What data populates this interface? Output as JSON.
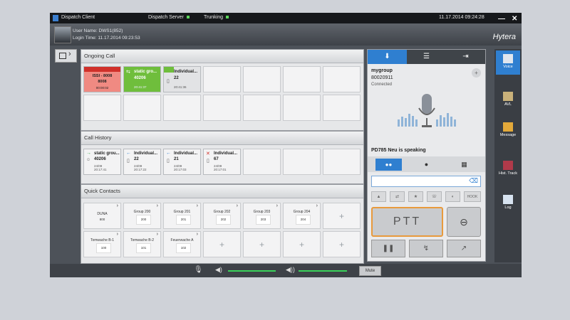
{
  "titlebar": {
    "app": "Dispatch Client",
    "server": "Dispatch Server",
    "trunking": "Trunking",
    "datetime": "11.17.2014 09:24:28",
    "min": "—",
    "close": "✕"
  },
  "user": {
    "name": "User Name: DWS1(852)",
    "login": "Login Time: 11.17.2014 09:23:53"
  },
  "brand": "Hytera",
  "ongoing": {
    "title": "Ongoing Call",
    "tiles": [
      {
        "name": "ISSI - 8008",
        "id": "8008",
        "time": "00:00:02",
        "color": "#f08a82"
      },
      {
        "name": "static gro...",
        "id": "40206",
        "time": "20:41:37",
        "color": "#6fbe3c"
      },
      {
        "name": "Individual...",
        "id": "22",
        "time": "20:41:36",
        "color": "#e2e3e5"
      }
    ]
  },
  "history": {
    "title": "Call History",
    "tiles": [
      {
        "name": "static grou...",
        "id": "40206",
        "date": "24/09",
        "time": "20:17:41"
      },
      {
        "name": "Individual...",
        "id": "22",
        "date": "24/09",
        "time": "20:17:22"
      },
      {
        "name": "Individual...",
        "id": "21",
        "date": "24/09",
        "time": "20:17:03"
      },
      {
        "name": "Individual...",
        "id": "67",
        "date": "24/09",
        "time": "20:17:01"
      }
    ]
  },
  "contacts": {
    "title": "Quick Contacts",
    "row1": [
      {
        "name": "DUNA",
        "id": "800"
      },
      {
        "name": "Group 200",
        "id": "200"
      },
      {
        "name": "Group 201",
        "id": "201"
      },
      {
        "name": "Group 202",
        "id": "202"
      },
      {
        "name": "Group 203",
        "id": "203"
      },
      {
        "name": "Group 204",
        "id": "204"
      }
    ],
    "row2": [
      {
        "name": "Tomwache B-1",
        "id": "100"
      },
      {
        "name": "Tomwache B-2",
        "id": "101"
      },
      {
        "name": "Feuerwache A",
        "id": "102"
      }
    ],
    "plus": "+"
  },
  "right": {
    "group": "mygroup",
    "number": "80020911",
    "status": "Connected",
    "speaking": "PD785 Neu is speaking",
    "ptt": "PTT",
    "hook": "HOOK"
  },
  "sidebar": [
    {
      "label": "Voice"
    },
    {
      "label": "AVL"
    },
    {
      "label": "Message"
    },
    {
      "label": "Hist. Track"
    },
    {
      "label": "Log"
    }
  ],
  "bottom": {
    "mute": "Mute"
  },
  "colors": {
    "accent": "#2f7fd0",
    "green": "#39d25a",
    "ptt_border": "#e89a3c"
  }
}
